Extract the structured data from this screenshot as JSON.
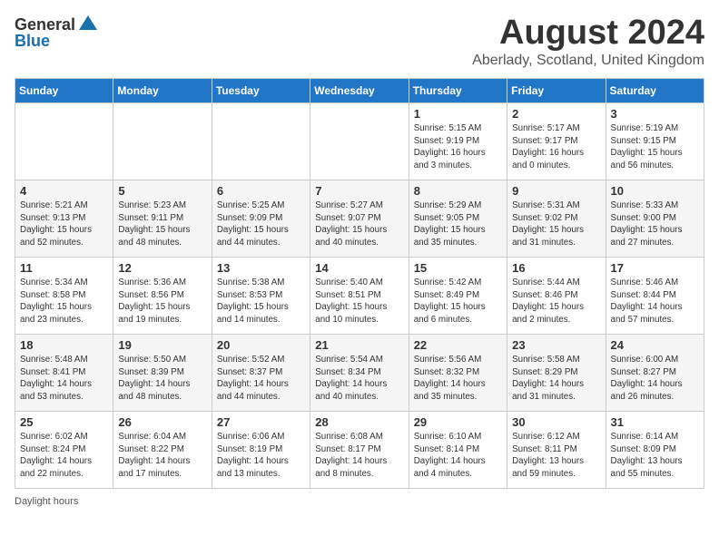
{
  "header": {
    "logo_general": "General",
    "logo_blue": "Blue",
    "month_title": "August 2024",
    "location": "Aberlady, Scotland, United Kingdom"
  },
  "days_of_week": [
    "Sunday",
    "Monday",
    "Tuesday",
    "Wednesday",
    "Thursday",
    "Friday",
    "Saturday"
  ],
  "weeks": [
    [
      {
        "day": "",
        "info": ""
      },
      {
        "day": "",
        "info": ""
      },
      {
        "day": "",
        "info": ""
      },
      {
        "day": "",
        "info": ""
      },
      {
        "day": "1",
        "info": "Sunrise: 5:15 AM\nSunset: 9:19 PM\nDaylight: 16 hours\nand 3 minutes."
      },
      {
        "day": "2",
        "info": "Sunrise: 5:17 AM\nSunset: 9:17 PM\nDaylight: 16 hours\nand 0 minutes."
      },
      {
        "day": "3",
        "info": "Sunrise: 5:19 AM\nSunset: 9:15 PM\nDaylight: 15 hours\nand 56 minutes."
      }
    ],
    [
      {
        "day": "4",
        "info": "Sunrise: 5:21 AM\nSunset: 9:13 PM\nDaylight: 15 hours\nand 52 minutes."
      },
      {
        "day": "5",
        "info": "Sunrise: 5:23 AM\nSunset: 9:11 PM\nDaylight: 15 hours\nand 48 minutes."
      },
      {
        "day": "6",
        "info": "Sunrise: 5:25 AM\nSunset: 9:09 PM\nDaylight: 15 hours\nand 44 minutes."
      },
      {
        "day": "7",
        "info": "Sunrise: 5:27 AM\nSunset: 9:07 PM\nDaylight: 15 hours\nand 40 minutes."
      },
      {
        "day": "8",
        "info": "Sunrise: 5:29 AM\nSunset: 9:05 PM\nDaylight: 15 hours\nand 35 minutes."
      },
      {
        "day": "9",
        "info": "Sunrise: 5:31 AM\nSunset: 9:02 PM\nDaylight: 15 hours\nand 31 minutes."
      },
      {
        "day": "10",
        "info": "Sunrise: 5:33 AM\nSunset: 9:00 PM\nDaylight: 15 hours\nand 27 minutes."
      }
    ],
    [
      {
        "day": "11",
        "info": "Sunrise: 5:34 AM\nSunset: 8:58 PM\nDaylight: 15 hours\nand 23 minutes."
      },
      {
        "day": "12",
        "info": "Sunrise: 5:36 AM\nSunset: 8:56 PM\nDaylight: 15 hours\nand 19 minutes."
      },
      {
        "day": "13",
        "info": "Sunrise: 5:38 AM\nSunset: 8:53 PM\nDaylight: 15 hours\nand 14 minutes."
      },
      {
        "day": "14",
        "info": "Sunrise: 5:40 AM\nSunset: 8:51 PM\nDaylight: 15 hours\nand 10 minutes."
      },
      {
        "day": "15",
        "info": "Sunrise: 5:42 AM\nSunset: 8:49 PM\nDaylight: 15 hours\nand 6 minutes."
      },
      {
        "day": "16",
        "info": "Sunrise: 5:44 AM\nSunset: 8:46 PM\nDaylight: 15 hours\nand 2 minutes."
      },
      {
        "day": "17",
        "info": "Sunrise: 5:46 AM\nSunset: 8:44 PM\nDaylight: 14 hours\nand 57 minutes."
      }
    ],
    [
      {
        "day": "18",
        "info": "Sunrise: 5:48 AM\nSunset: 8:41 PM\nDaylight: 14 hours\nand 53 minutes."
      },
      {
        "day": "19",
        "info": "Sunrise: 5:50 AM\nSunset: 8:39 PM\nDaylight: 14 hours\nand 48 minutes."
      },
      {
        "day": "20",
        "info": "Sunrise: 5:52 AM\nSunset: 8:37 PM\nDaylight: 14 hours\nand 44 minutes."
      },
      {
        "day": "21",
        "info": "Sunrise: 5:54 AM\nSunset: 8:34 PM\nDaylight: 14 hours\nand 40 minutes."
      },
      {
        "day": "22",
        "info": "Sunrise: 5:56 AM\nSunset: 8:32 PM\nDaylight: 14 hours\nand 35 minutes."
      },
      {
        "day": "23",
        "info": "Sunrise: 5:58 AM\nSunset: 8:29 PM\nDaylight: 14 hours\nand 31 minutes."
      },
      {
        "day": "24",
        "info": "Sunrise: 6:00 AM\nSunset: 8:27 PM\nDaylight: 14 hours\nand 26 minutes."
      }
    ],
    [
      {
        "day": "25",
        "info": "Sunrise: 6:02 AM\nSunset: 8:24 PM\nDaylight: 14 hours\nand 22 minutes."
      },
      {
        "day": "26",
        "info": "Sunrise: 6:04 AM\nSunset: 8:22 PM\nDaylight: 14 hours\nand 17 minutes."
      },
      {
        "day": "27",
        "info": "Sunrise: 6:06 AM\nSunset: 8:19 PM\nDaylight: 14 hours\nand 13 minutes."
      },
      {
        "day": "28",
        "info": "Sunrise: 6:08 AM\nSunset: 8:17 PM\nDaylight: 14 hours\nand 8 minutes."
      },
      {
        "day": "29",
        "info": "Sunrise: 6:10 AM\nSunset: 8:14 PM\nDaylight: 14 hours\nand 4 minutes."
      },
      {
        "day": "30",
        "info": "Sunrise: 6:12 AM\nSunset: 8:11 PM\nDaylight: 13 hours\nand 59 minutes."
      },
      {
        "day": "31",
        "info": "Sunrise: 6:14 AM\nSunset: 8:09 PM\nDaylight: 13 hours\nand 55 minutes."
      }
    ]
  ],
  "footer": {
    "daylight_label": "Daylight hours"
  }
}
